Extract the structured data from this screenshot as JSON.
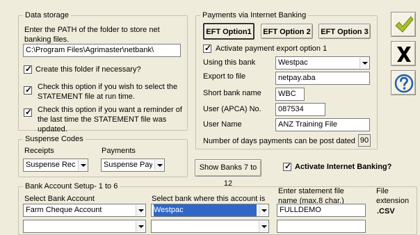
{
  "data_storage": {
    "title": "Data storage",
    "path_label": "Enter the PATH of the folder to store net banking files.",
    "path_value": "C:\\Program Files\\Agrimaster\\netbank\\",
    "create_folder_label": "Create this folder if necessary?",
    "create_folder_checked": true,
    "select_statement_label": "Check this option if you wish to select the STATEMENT file at run time.",
    "select_statement_checked": true,
    "reminder_label": "Check this option if you want a reminder of the last time the STATEMENT file was updated.",
    "reminder_checked": true
  },
  "suspense_codes": {
    "title": "Suspense Codes",
    "receipts_label": "Receipts",
    "payments_label": "Payments",
    "receipts_value": "Suspense Receipt",
    "payments_value": "Suspense Payme"
  },
  "payments": {
    "title": "Payments via Internet Banking",
    "tabs": [
      "EFT Option1",
      "EFT Option 2",
      "EFT Option 3"
    ],
    "activate_export_label": "Activate payment export option 1",
    "activate_export_checked": true,
    "using_bank_label": "Using this bank",
    "using_bank_value": "Westpac",
    "export_file_label": "Export to file",
    "export_file_value": "netpay.aba",
    "short_bank_label": "Short bank name",
    "short_bank_value": "WBC",
    "user_apca_label": "User (APCA) No.",
    "user_apca_value": "087534",
    "user_name_label": "User Name",
    "user_name_value": "ANZ Training File",
    "days_label": "Number of days payments can be post dated",
    "days_value": "90"
  },
  "show_banks_label": "Show Banks 7 to 12",
  "activate_internet_label": "Activate Internet Banking?",
  "activate_internet_checked": true,
  "bank_setup": {
    "title": "Bank Account Setup- 1 to 6",
    "select_account_label": "Select Bank Account",
    "select_bank_label": "Select bank where this account is",
    "statement_file_label": "Enter statement file name (max.8 char.)",
    "extension_label": "File extension",
    "row1_account": "Farm Cheque Account",
    "row1_bank": "Westpac",
    "row1_file": "FULLDEMO",
    "row1_ext": ".CSV",
    "row2_account": "",
    "row2_bank": "",
    "row2_file": ""
  },
  "side_buttons": [
    "check-icon",
    "close-icon",
    "help-icon"
  ],
  "colors": {
    "background": "#f0ecdb",
    "selection": "#3067c7",
    "check_green": "#a6c02a",
    "help_blue": "#1d5fb0"
  }
}
